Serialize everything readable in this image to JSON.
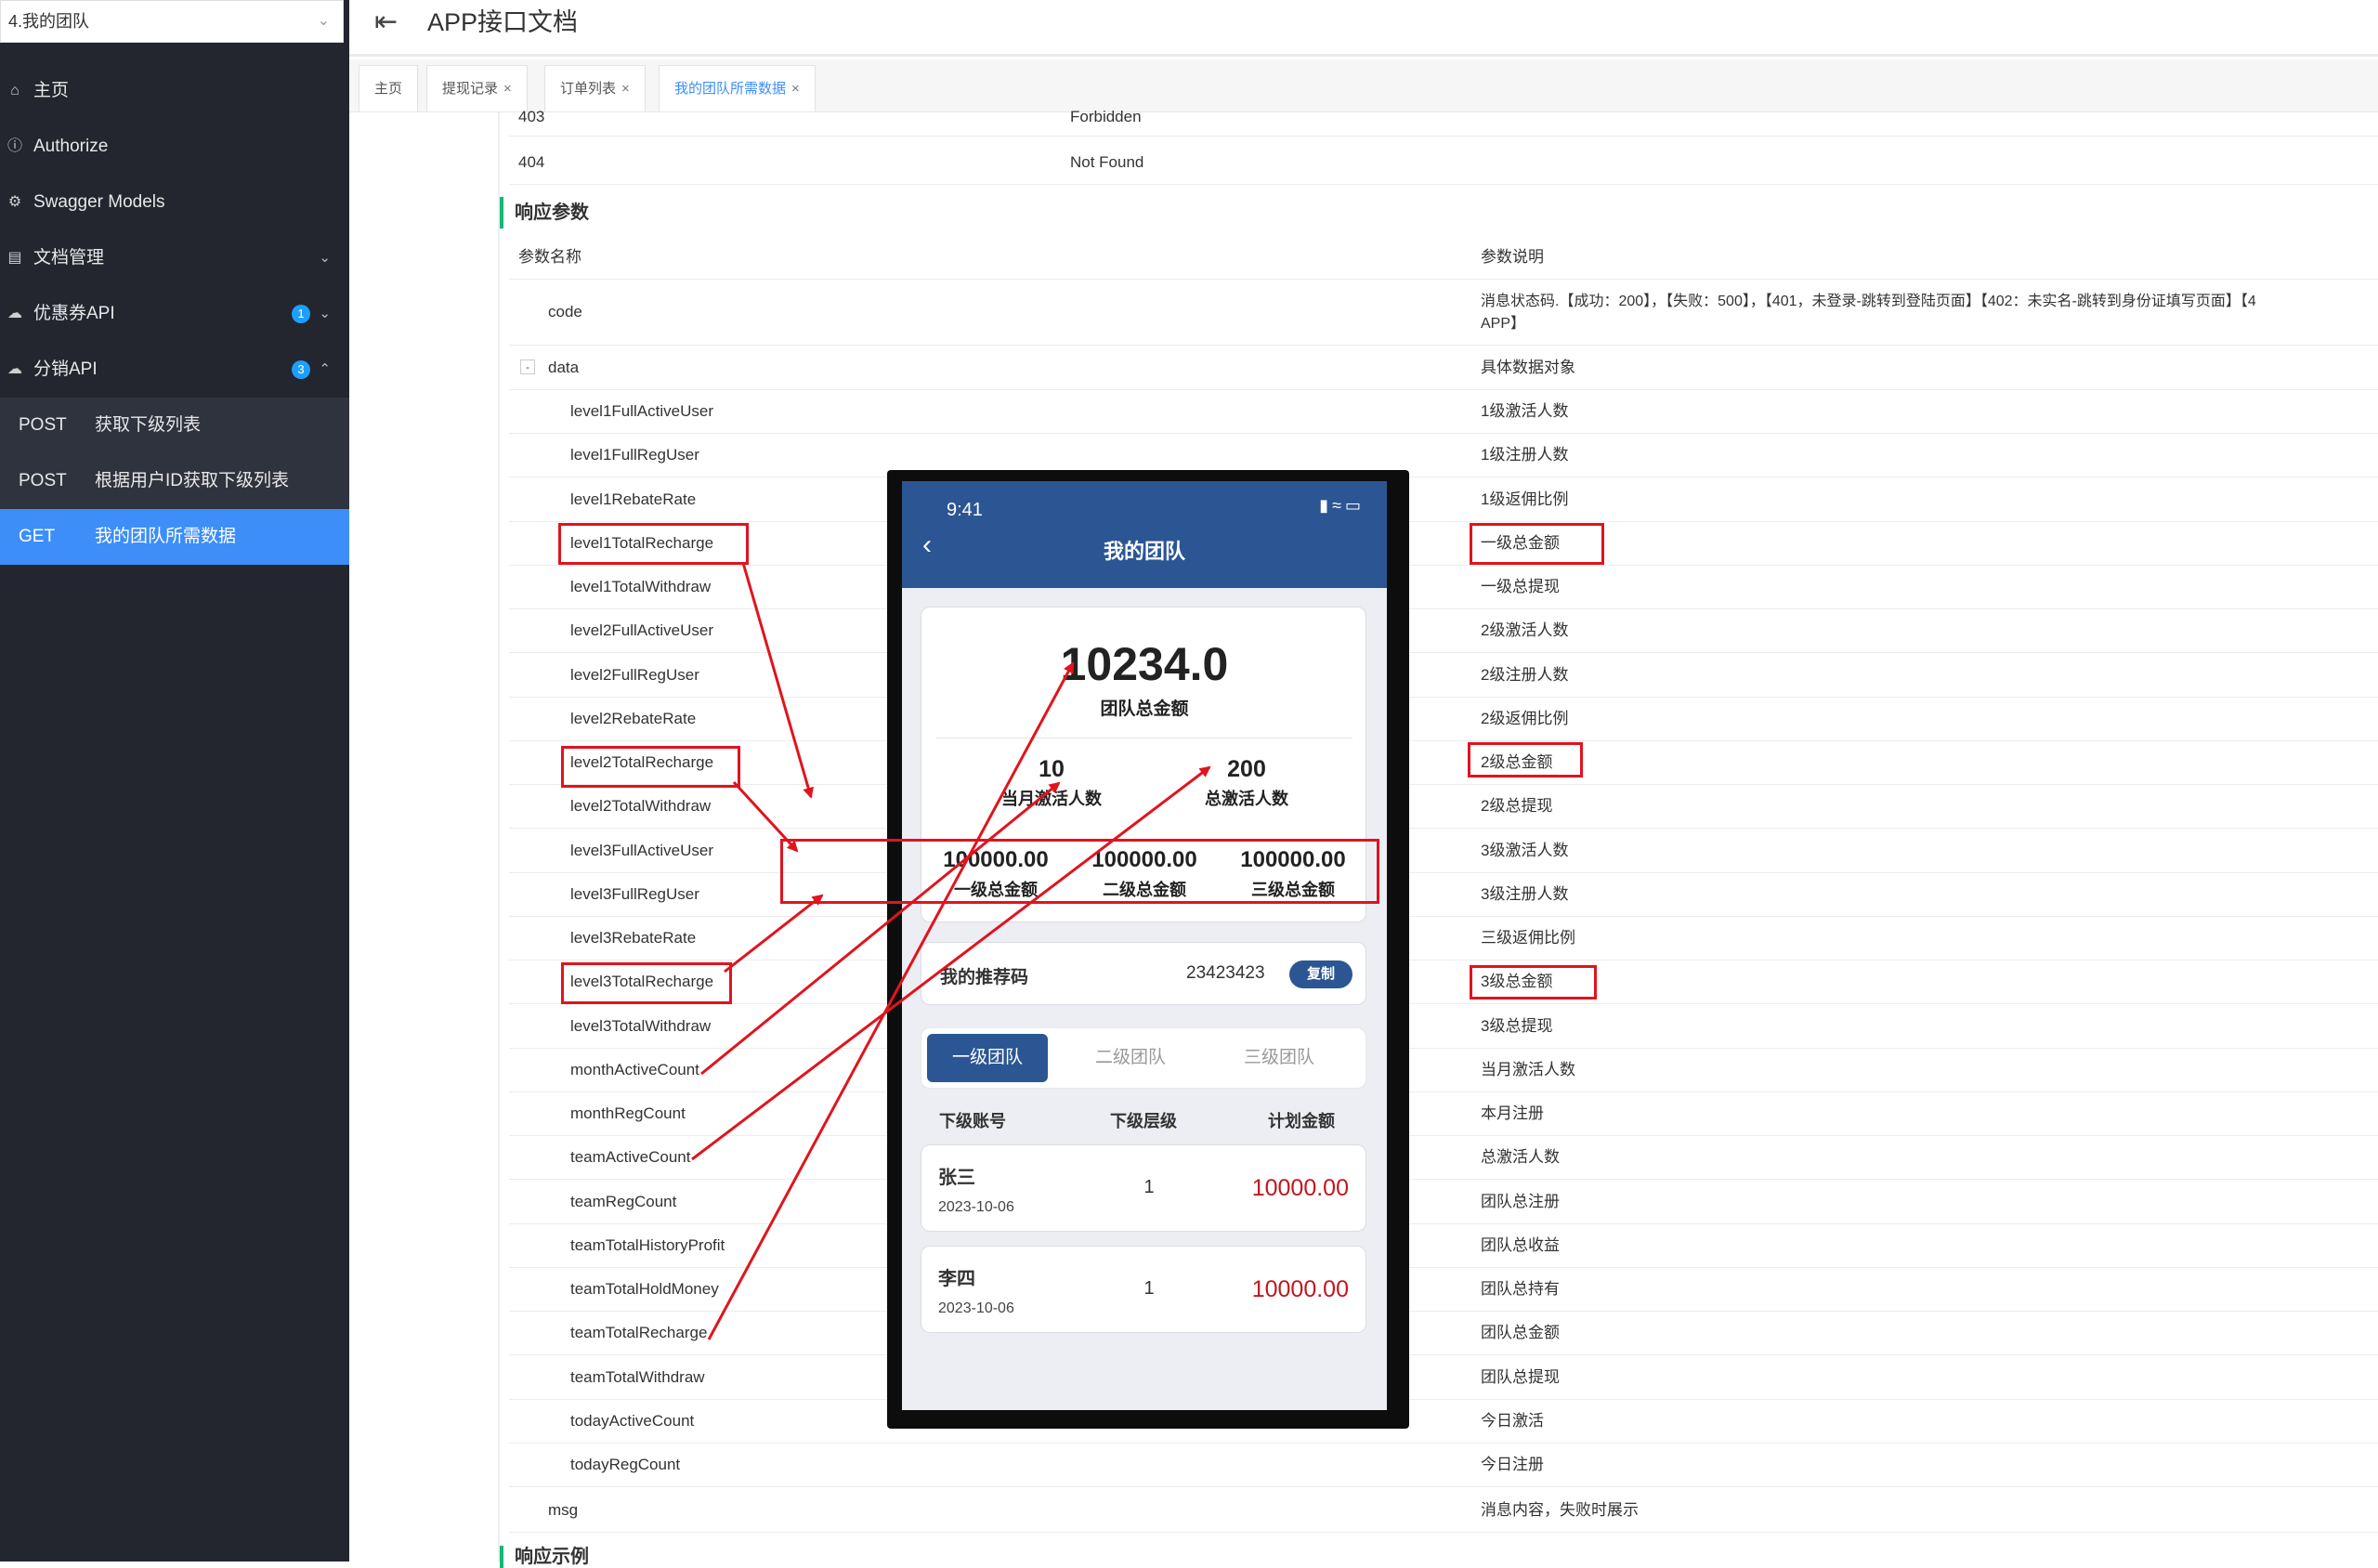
{
  "sidebar": {
    "group_select": "4.我的团队",
    "items": [
      {
        "label": "主页"
      },
      {
        "label": "Authorize"
      },
      {
        "label": "Swagger Models"
      },
      {
        "label": "文档管理"
      },
      {
        "label": "优惠券API",
        "badge": "1"
      },
      {
        "label": "分销API",
        "badge": "3"
      }
    ],
    "sub_items": [
      {
        "method": "POST",
        "label": "获取下级列表"
      },
      {
        "method": "POST",
        "label": "根据用户ID获取下级列表"
      },
      {
        "method": "GET",
        "label": "我的团队所需数据"
      }
    ]
  },
  "header": {
    "title": "APP接口文档"
  },
  "tabs": [
    {
      "label": "主页"
    },
    {
      "label": "提现记录"
    },
    {
      "label": "订单列表"
    },
    {
      "label": "我的团队所需数据"
    }
  ],
  "status_rows": [
    {
      "code": "403",
      "desc": "Forbidden"
    },
    {
      "code": "404",
      "desc": "Not Found"
    }
  ],
  "response": {
    "title": "响应参数",
    "col_name": "参数名称",
    "col_desc": "参数说明",
    "code": {
      "name": "code",
      "desc_line1": "消息状态码.【成功：200】，【失败：500】，【401，未登录-跳转到登陆页面】【402：未实名-跳转到身份证填写页面】【4",
      "desc_line2": "APP】"
    },
    "data": {
      "toggle": "-",
      "name": "data",
      "desc": "具体数据对象"
    },
    "fields": [
      {
        "name": "level1FullActiveUser",
        "desc": "1级激活人数"
      },
      {
        "name": "level1FullRegUser",
        "desc": "1级注册人数"
      },
      {
        "name": "level1RebateRate",
        "desc": "1级返佣比例"
      },
      {
        "name": "level1TotalRecharge",
        "desc": "一级总金额"
      },
      {
        "name": "level1TotalWithdraw",
        "desc": "一级总提现"
      },
      {
        "name": "level2FullActiveUser",
        "desc": "2级激活人数"
      },
      {
        "name": "level2FullRegUser",
        "desc": "2级注册人数"
      },
      {
        "name": "level2RebateRate",
        "desc": "2级返佣比例"
      },
      {
        "name": "level2TotalRecharge",
        "desc": "2级总金额"
      },
      {
        "name": "level2TotalWithdraw",
        "desc": "2级总提现"
      },
      {
        "name": "level3FullActiveUser",
        "desc": "3级激活人数"
      },
      {
        "name": "level3FullRegUser",
        "desc": "3级注册人数"
      },
      {
        "name": "level3RebateRate",
        "desc": "三级返佣比例"
      },
      {
        "name": "level3TotalRecharge",
        "desc": "3级总金额"
      },
      {
        "name": "level3TotalWithdraw",
        "desc": "3级总提现"
      },
      {
        "name": "monthActiveCount",
        "desc": "当月激活人数"
      },
      {
        "name": "monthRegCount",
        "desc": "本月注册"
      },
      {
        "name": "teamActiveCount",
        "desc": "总激活人数"
      },
      {
        "name": "teamRegCount",
        "desc": "团队总注册"
      },
      {
        "name": "teamTotalHistoryProfit",
        "desc": "团队总收益"
      },
      {
        "name": "teamTotalHoldMoney",
        "desc": "团队总持有"
      },
      {
        "name": "teamTotalRecharge",
        "desc": "团队总金额"
      },
      {
        "name": "teamTotalWithdraw",
        "desc": "团队总提现"
      },
      {
        "name": "todayActiveCount",
        "desc": "今日激活"
      },
      {
        "name": "todayRegCount",
        "desc": "今日注册"
      }
    ],
    "msg": {
      "name": "msg",
      "desc": "消息内容，失败时展示"
    }
  },
  "example_title": "响应示例",
  "phone": {
    "time": "9:41",
    "title": "我的团队",
    "total_amount": "10234.0",
    "total_amount_label": "团队总金额",
    "month_active": "10",
    "month_active_label": "当月激活人数",
    "total_active": "200",
    "total_active_label": "总激活人数",
    "levels": [
      {
        "amount": "100000.00",
        "label": "一级总金额"
      },
      {
        "amount": "100000.00",
        "label": "二级总金额"
      },
      {
        "amount": "100000.00",
        "label": "三级总金额"
      }
    ],
    "referral_label": "我的推荐码",
    "referral_code": "23423423",
    "copy_label": "复制",
    "team_tabs": [
      "一级团队",
      "二级团队",
      "三级团队"
    ],
    "list_headers": [
      "下级账号",
      "下级层级",
      "计划金额"
    ],
    "list": [
      {
        "name": "张三",
        "date": "2023-10-06",
        "level": "1",
        "amount": "10000.00"
      },
      {
        "name": "李四",
        "date": "2023-10-06",
        "level": "1",
        "amount": "10000.00"
      }
    ]
  },
  "colors": {
    "sidebar_bg": "#23262e",
    "active_blue": "#3d8ef8",
    "phone_header": "#2b5693",
    "annotation_red": "#e0141e",
    "amount_red": "#c0171f",
    "section_green": "#16b777"
  }
}
